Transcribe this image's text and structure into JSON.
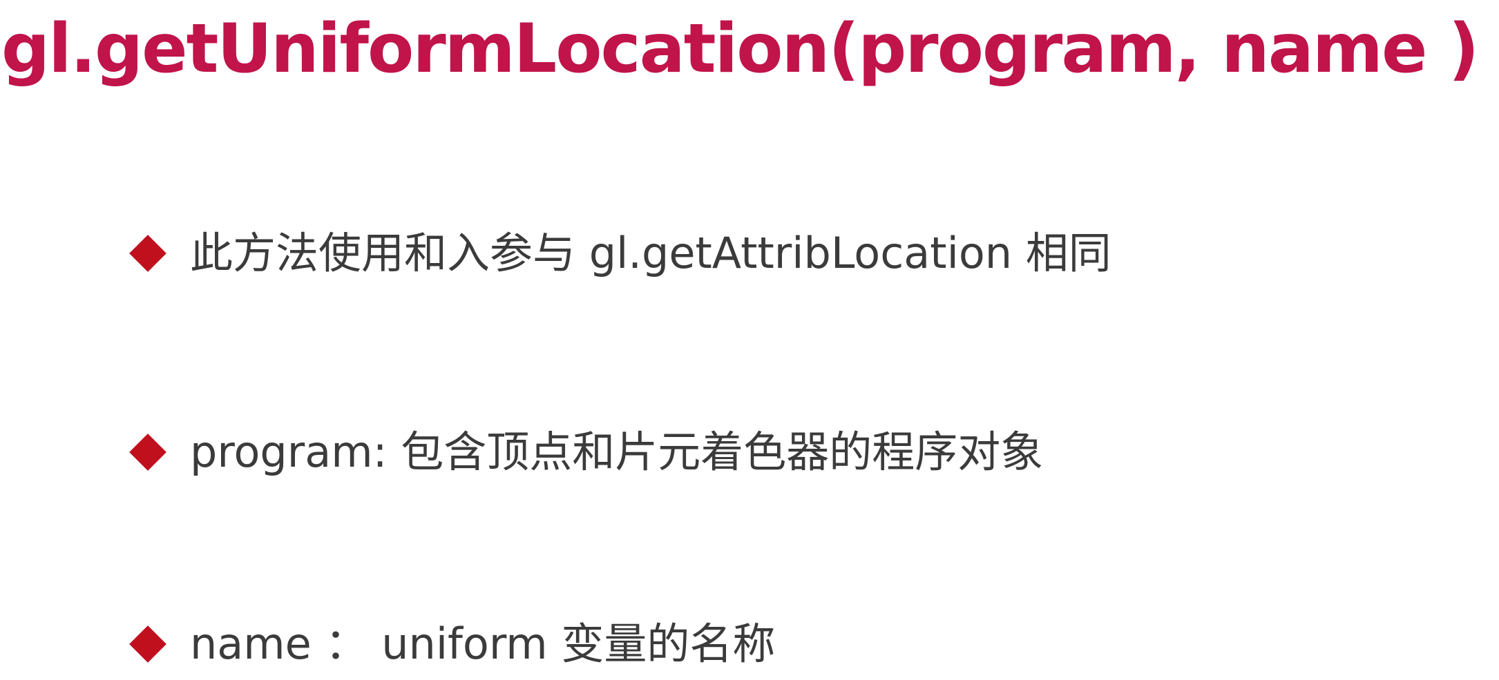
{
  "slide": {
    "title": "gl.getUniformLocation(program, name )",
    "bullets": [
      {
        "text": "此方法使用和入参与 gl.getAttribLocation 相同"
      },
      {
        "text": "program: 包含顶点和片元着色器的程序对象"
      },
      {
        "text": "name ：  uniform 变量的名称"
      }
    ]
  },
  "colors": {
    "title": "#c0144a",
    "bullet_marker": "#c0101e",
    "body_text": "#3b3b3b",
    "background": "#ffffff"
  }
}
